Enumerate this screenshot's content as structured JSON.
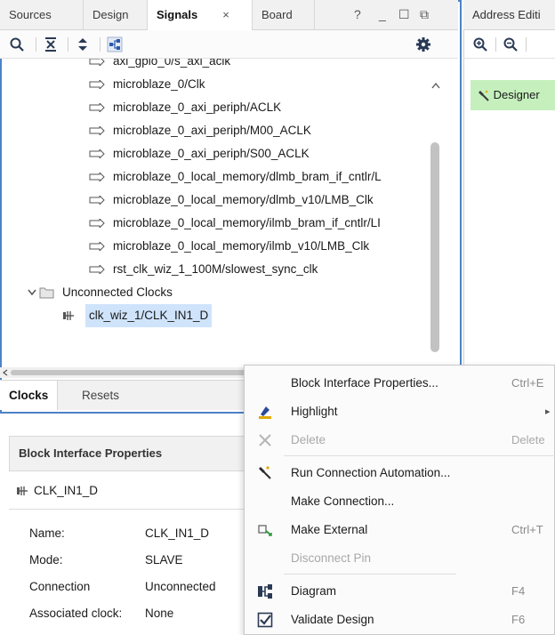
{
  "signals_panel": {
    "tabs": [
      {
        "label": "Sources"
      },
      {
        "label": "Design"
      },
      {
        "label": "Signals",
        "close": "×"
      },
      {
        "label": "Board"
      }
    ],
    "window_controls": [
      "?",
      "_",
      "☐",
      "⧉"
    ],
    "tree_rows": [
      {
        "label": "axi_gpio_0/s_axi_aclk",
        "icon": "signal-arrow-icon"
      },
      {
        "label": "microblaze_0/Clk",
        "icon": "signal-arrow-icon"
      },
      {
        "label": "microblaze_0_axi_periph/ACLK",
        "icon": "signal-arrow-icon"
      },
      {
        "label": "microblaze_0_axi_periph/M00_ACLK",
        "icon": "signal-arrow-icon"
      },
      {
        "label": "microblaze_0_axi_periph/S00_ACLK",
        "icon": "signal-arrow-icon"
      },
      {
        "label": "microblaze_0_local_memory/dlmb_bram_if_cntlr/L",
        "icon": "signal-arrow-icon"
      },
      {
        "label": "microblaze_0_local_memory/dlmb_v10/LMB_Clk",
        "icon": "signal-arrow-icon"
      },
      {
        "label": "microblaze_0_local_memory/ilmb_bram_if_cntlr/LI",
        "icon": "signal-arrow-icon"
      },
      {
        "label": "microblaze_0_local_memory/ilmb_v10/LMB_Clk",
        "icon": "signal-arrow-icon"
      },
      {
        "label": "rst_clk_wiz_1_100M/slowest_sync_clk",
        "icon": "signal-arrow-icon"
      }
    ],
    "group_label": "Unconnected Clocks",
    "selected_item": "clk_wiz_1/CLK_IN1_D",
    "bottom_tabs": [
      {
        "label": "Clocks"
      },
      {
        "label": "Resets"
      }
    ]
  },
  "address_editor": {
    "tab_label": "Address Editi",
    "banner": "Designer"
  },
  "properties": {
    "title": "Block Interface Properties",
    "subject": "CLK_IN1_D",
    "rows": [
      {
        "key": "Name:",
        "value": "CLK_IN1_D"
      },
      {
        "key": "Mode:",
        "value": "SLAVE"
      },
      {
        "key": "Connection",
        "value": "Unconnected"
      },
      {
        "key": "Associated clock:",
        "value": "None"
      }
    ]
  },
  "context_menu": {
    "items": [
      {
        "label": "Block Interface Properties...",
        "shortcut": "Ctrl+E",
        "disabled": false
      },
      {
        "label": "Highlight",
        "shortcut": "",
        "submenu": "▸",
        "disabled": false
      },
      {
        "label": "Delete",
        "shortcut": "Delete",
        "disabled": true
      },
      {
        "label": "Run Connection Automation...",
        "shortcut": "",
        "disabled": false
      },
      {
        "label": "Make Connection...",
        "shortcut": "",
        "disabled": false
      },
      {
        "label": "Make External",
        "shortcut": "Ctrl+T",
        "disabled": false
      },
      {
        "label": "Disconnect Pin",
        "shortcut": "",
        "disabled": true
      },
      {
        "label": "Diagram",
        "shortcut": "F4",
        "disabled": false
      },
      {
        "label": "Validate Design",
        "shortcut": "F6",
        "disabled": false
      }
    ]
  },
  "colors": {
    "accent_border": "#4d82c7",
    "selection": "#cfe3fb",
    "designer_banner": "#c5f0bd"
  }
}
